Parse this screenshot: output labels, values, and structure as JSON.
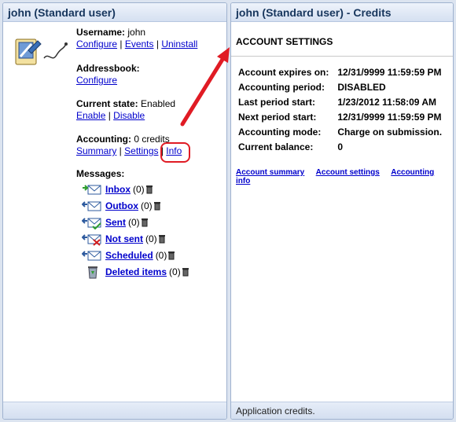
{
  "left_panel": {
    "title": "john (Standard user)",
    "username": {
      "label": "Username:",
      "value": "john",
      "links": [
        "Configure",
        "Events",
        "Uninstall"
      ]
    },
    "addressbook": {
      "label": "Addressbook:",
      "links": [
        "Configure"
      ]
    },
    "current_state": {
      "label": "Current state:",
      "value": "Enabled",
      "links": [
        "Enable",
        "Disable"
      ]
    },
    "accounting": {
      "label": "Accounting:",
      "value": "0 credits",
      "links": [
        "Summary",
        "Settings",
        "Info"
      ]
    },
    "messages": {
      "label": "Messages:",
      "items": [
        {
          "name": "Inbox",
          "count": "(0)",
          "icon": "inbox-icon"
        },
        {
          "name": "Outbox",
          "count": "(0)",
          "icon": "outbox-icon"
        },
        {
          "name": "Sent",
          "count": "(0)",
          "icon": "sent-icon"
        },
        {
          "name": "Not sent",
          "count": "(0)",
          "icon": "not-sent-icon"
        },
        {
          "name": "Scheduled",
          "count": "(0)",
          "icon": "scheduled-icon"
        },
        {
          "name": "Deleted items",
          "count": "(0)",
          "icon": "recycle-bin-icon"
        }
      ]
    }
  },
  "right_panel": {
    "title": "john (Standard user) - Credits",
    "section_title": "ACCOUNT SETTINGS",
    "settings": [
      {
        "key": "Account expires on:",
        "value": "12/31/9999 11:59:59 PM"
      },
      {
        "key": "Accounting period:",
        "value": "DISABLED"
      },
      {
        "key": "Last period start:",
        "value": "1/23/2012 11:58:09 AM"
      },
      {
        "key": "Next period start:",
        "value": "12/31/9999 11:59:59 PM"
      },
      {
        "key": "Accounting mode:",
        "value": "Charge on submission."
      },
      {
        "key": "Current balance:",
        "value": "0"
      }
    ],
    "links": [
      "Account summary",
      "Account settings",
      "Accounting info"
    ],
    "footer": "Application credits."
  },
  "colors": {
    "link": "#0000cc",
    "title_text": "#17365d",
    "annotation": "#e01b24"
  }
}
